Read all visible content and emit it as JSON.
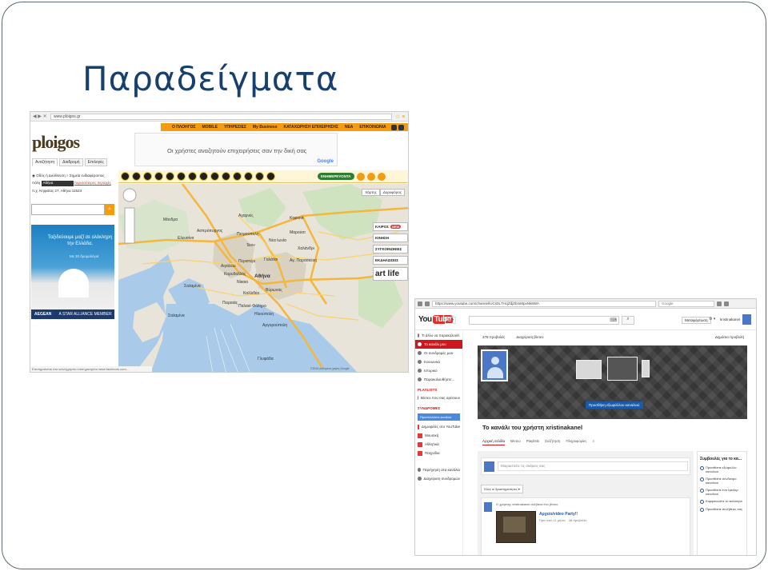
{
  "slide": {
    "title": "Παραδείγματα"
  },
  "ploigos": {
    "browser_url": "www.ploigos.gr",
    "nav_items": [
      "Ο ΠΛΟΗΓΟΣ",
      "MOBILE",
      "ΥΠΗΡΕΣΙΕΣ",
      "My Business",
      "ΚΑΤΑΧΩΡΗΣΗ ΕΠΙΧΕΙΡΗΣΗΣ",
      "ΝΕΑ",
      "ΕΠΙΚΟΙΝΩΝΙΑ"
    ],
    "logo": "ploigos",
    "ad_text": "Οι χρήστες αναζητούν επιχειρήσεις σαν την δική σας",
    "ad_brand": "Google",
    "tabs": [
      "Αναζήτηση",
      "Διαδρομή",
      "Επιλογές"
    ],
    "search_mode_1": "Οδός ή Διεύθυνση",
    "search_mode_2": "Σημεία ενδιαφέροντος",
    "city_label": "πόλη",
    "city_value": "Αθήνα",
    "interest_points_link": "περισσότερες περιοχές",
    "example_address": "π.χ. Κηφισίας 27, Αθήνα 11523",
    "update_button": "ΕΝΗΜΕΡΕΥΟΝΤΑ",
    "map_type": [
      "Χάρτης",
      "Δορυφόρος"
    ],
    "banner_title": "Ταξιδεύουμε μαζί σε ολόκληρη την Ελλάδα.",
    "banner_sub": "Με 30 δρομολόγια",
    "banner_brand": "AEGEAN",
    "banner_alliance": "A STAR ALLIANCE MEMBER",
    "layers": [
      "ΚΑΙΡΟΣ",
      "ΚΙΝΗΣΗ",
      "ΣΥΓΚΟΙΝΩΝΙΕΣ",
      "ΕΚΔΗΛΩΣΕΙΣ"
    ],
    "new_badge": "NEW",
    "art_logo": "art life",
    "status_text": "Επισημαίνεται στο κοινόχρηστο επισημασμένο www.facebook.com...",
    "map_copyright": "©2014 Δεδομένα χάρτη Google",
    "map_labels": [
      "Αχαρνές",
      "Κηφισιά",
      "Μαρούσι",
      "Χαλάνδρι",
      "Νέα Ιωνία",
      "Μάνδρα",
      "Ελευσίνα",
      "Ασπρόπυργος",
      "Πετρούπολη",
      "Ίλιον",
      "Περιστέρι",
      "Γαλάτσι",
      "Αγ. Παρασκευή",
      "Κορυδαλλός",
      "Νίκαια",
      "Πειραιάς",
      "Καλλιθέα",
      "Βύρωνας",
      "Σαλαμίνα",
      "Αιγάλεω",
      "Γλυφάδα",
      "Αργυρούπολη",
      "Ηλιούπολη",
      "Παλαιό Φάληρο",
      "Σαλαμίνα"
    ],
    "map_city": "Αθήνα"
  },
  "youtube": {
    "browser_url": "https://www.youtube.com/channel/UCs0L7HcjZdjZbmMpxNk8WA",
    "browser_search": "Google",
    "logo_you": "You",
    "logo_tube": "Tube",
    "search_placeholder": "",
    "upload_button": "Μεταφόρτωση",
    "user_name": "kristinakanel",
    "sidebar_items": [
      "Τι άλλο να παρακολουθ.",
      "Το κανάλι μου",
      "Οι συνδρομές μου",
      "Κοινωνικό",
      "Ιστορικό",
      "Παρακολουθήστε..."
    ],
    "sidebar_playlists_head": "PLAYLISTS",
    "sidebar_playlist_item": "Βίντεο που σας αρέσουν",
    "sidebar_subs_head": "ΣΥΝΔΡΟΜΕΣ",
    "sidebar_subs_button": "Προσπελάστε κανάλια",
    "sidebar_subs_items": [
      "Δημοφιλές στο YouTube",
      "Μουσική",
      "Αθλητικά",
      "Παιχνίδια"
    ],
    "sidebar_bottom": [
      "Περιήγηση στα κανάλια",
      "Διαχείριση συνδρομών"
    ],
    "channel_subscribers": "378 προβολές",
    "channel_manager": "Διαχείριση βίντεο",
    "channel_tips_link": "Δημόσια προβολή",
    "channel_art_button": "Προσθήκη εξωφύλλου καναλιού",
    "channel_name": "Το κανάλι του χρήστη xristinakanel",
    "channel_tabs": [
      "Αρχική σελίδα",
      "Βίντεο",
      "Playlists",
      "Συζήτηση",
      "Πληροφορίες"
    ],
    "share_placeholder": "Μοιραστείτε τις σκέψεις σας",
    "filter_label": "Όλες οι δραστηριότητες ▾",
    "feed_line": "Ο χρήστης xristinakanel ανέβασε ένα βίντεο",
    "video_title": "Αρχείο/video Party!!",
    "video_meta": "Πριν από 11 μήνες · 38 προβολές",
    "tips_title": "Συμβουλές για το κα...",
    "tips_items": [
      "Προσθέστε εξώφυλλο καναλιού",
      "Προσθέστε σύνδεσμο καναλιού",
      "Προσθέστε ένα τρέιλερ καναλιού",
      "Καρφιτσώστε το καλύτερο",
      "Προσθέστε συνήθειες σας"
    ]
  }
}
